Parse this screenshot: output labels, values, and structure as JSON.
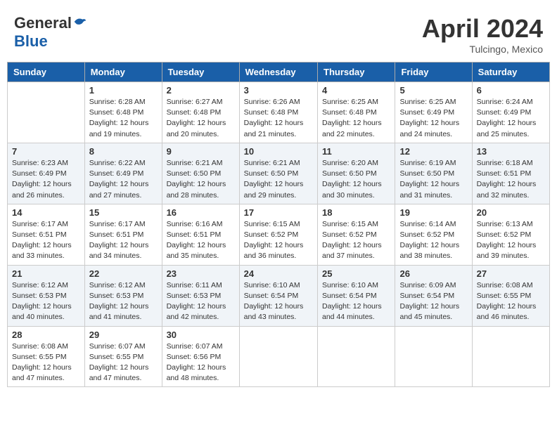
{
  "header": {
    "logo_general": "General",
    "logo_blue": "Blue",
    "month_title": "April 2024",
    "location": "Tulcingo, Mexico"
  },
  "weekdays": [
    "Sunday",
    "Monday",
    "Tuesday",
    "Wednesday",
    "Thursday",
    "Friday",
    "Saturday"
  ],
  "weeks": [
    [
      {
        "day": "",
        "sunrise": "",
        "sunset": "",
        "daylight": ""
      },
      {
        "day": "1",
        "sunrise": "Sunrise: 6:28 AM",
        "sunset": "Sunset: 6:48 PM",
        "daylight": "Daylight: 12 hours and 19 minutes."
      },
      {
        "day": "2",
        "sunrise": "Sunrise: 6:27 AM",
        "sunset": "Sunset: 6:48 PM",
        "daylight": "Daylight: 12 hours and 20 minutes."
      },
      {
        "day": "3",
        "sunrise": "Sunrise: 6:26 AM",
        "sunset": "Sunset: 6:48 PM",
        "daylight": "Daylight: 12 hours and 21 minutes."
      },
      {
        "day": "4",
        "sunrise": "Sunrise: 6:25 AM",
        "sunset": "Sunset: 6:48 PM",
        "daylight": "Daylight: 12 hours and 22 minutes."
      },
      {
        "day": "5",
        "sunrise": "Sunrise: 6:25 AM",
        "sunset": "Sunset: 6:49 PM",
        "daylight": "Daylight: 12 hours and 24 minutes."
      },
      {
        "day": "6",
        "sunrise": "Sunrise: 6:24 AM",
        "sunset": "Sunset: 6:49 PM",
        "daylight": "Daylight: 12 hours and 25 minutes."
      }
    ],
    [
      {
        "day": "7",
        "sunrise": "Sunrise: 6:23 AM",
        "sunset": "Sunset: 6:49 PM",
        "daylight": "Daylight: 12 hours and 26 minutes."
      },
      {
        "day": "8",
        "sunrise": "Sunrise: 6:22 AM",
        "sunset": "Sunset: 6:49 PM",
        "daylight": "Daylight: 12 hours and 27 minutes."
      },
      {
        "day": "9",
        "sunrise": "Sunrise: 6:21 AM",
        "sunset": "Sunset: 6:50 PM",
        "daylight": "Daylight: 12 hours and 28 minutes."
      },
      {
        "day": "10",
        "sunrise": "Sunrise: 6:21 AM",
        "sunset": "Sunset: 6:50 PM",
        "daylight": "Daylight: 12 hours and 29 minutes."
      },
      {
        "day": "11",
        "sunrise": "Sunrise: 6:20 AM",
        "sunset": "Sunset: 6:50 PM",
        "daylight": "Daylight: 12 hours and 30 minutes."
      },
      {
        "day": "12",
        "sunrise": "Sunrise: 6:19 AM",
        "sunset": "Sunset: 6:50 PM",
        "daylight": "Daylight: 12 hours and 31 minutes."
      },
      {
        "day": "13",
        "sunrise": "Sunrise: 6:18 AM",
        "sunset": "Sunset: 6:51 PM",
        "daylight": "Daylight: 12 hours and 32 minutes."
      }
    ],
    [
      {
        "day": "14",
        "sunrise": "Sunrise: 6:17 AM",
        "sunset": "Sunset: 6:51 PM",
        "daylight": "Daylight: 12 hours and 33 minutes."
      },
      {
        "day": "15",
        "sunrise": "Sunrise: 6:17 AM",
        "sunset": "Sunset: 6:51 PM",
        "daylight": "Daylight: 12 hours and 34 minutes."
      },
      {
        "day": "16",
        "sunrise": "Sunrise: 6:16 AM",
        "sunset": "Sunset: 6:51 PM",
        "daylight": "Daylight: 12 hours and 35 minutes."
      },
      {
        "day": "17",
        "sunrise": "Sunrise: 6:15 AM",
        "sunset": "Sunset: 6:52 PM",
        "daylight": "Daylight: 12 hours and 36 minutes."
      },
      {
        "day": "18",
        "sunrise": "Sunrise: 6:15 AM",
        "sunset": "Sunset: 6:52 PM",
        "daylight": "Daylight: 12 hours and 37 minutes."
      },
      {
        "day": "19",
        "sunrise": "Sunrise: 6:14 AM",
        "sunset": "Sunset: 6:52 PM",
        "daylight": "Daylight: 12 hours and 38 minutes."
      },
      {
        "day": "20",
        "sunrise": "Sunrise: 6:13 AM",
        "sunset": "Sunset: 6:52 PM",
        "daylight": "Daylight: 12 hours and 39 minutes."
      }
    ],
    [
      {
        "day": "21",
        "sunrise": "Sunrise: 6:12 AM",
        "sunset": "Sunset: 6:53 PM",
        "daylight": "Daylight: 12 hours and 40 minutes."
      },
      {
        "day": "22",
        "sunrise": "Sunrise: 6:12 AM",
        "sunset": "Sunset: 6:53 PM",
        "daylight": "Daylight: 12 hours and 41 minutes."
      },
      {
        "day": "23",
        "sunrise": "Sunrise: 6:11 AM",
        "sunset": "Sunset: 6:53 PM",
        "daylight": "Daylight: 12 hours and 42 minutes."
      },
      {
        "day": "24",
        "sunrise": "Sunrise: 6:10 AM",
        "sunset": "Sunset: 6:54 PM",
        "daylight": "Daylight: 12 hours and 43 minutes."
      },
      {
        "day": "25",
        "sunrise": "Sunrise: 6:10 AM",
        "sunset": "Sunset: 6:54 PM",
        "daylight": "Daylight: 12 hours and 44 minutes."
      },
      {
        "day": "26",
        "sunrise": "Sunrise: 6:09 AM",
        "sunset": "Sunset: 6:54 PM",
        "daylight": "Daylight: 12 hours and 45 minutes."
      },
      {
        "day": "27",
        "sunrise": "Sunrise: 6:08 AM",
        "sunset": "Sunset: 6:55 PM",
        "daylight": "Daylight: 12 hours and 46 minutes."
      }
    ],
    [
      {
        "day": "28",
        "sunrise": "Sunrise: 6:08 AM",
        "sunset": "Sunset: 6:55 PM",
        "daylight": "Daylight: 12 hours and 47 minutes."
      },
      {
        "day": "29",
        "sunrise": "Sunrise: 6:07 AM",
        "sunset": "Sunset: 6:55 PM",
        "daylight": "Daylight: 12 hours and 47 minutes."
      },
      {
        "day": "30",
        "sunrise": "Sunrise: 6:07 AM",
        "sunset": "Sunset: 6:56 PM",
        "daylight": "Daylight: 12 hours and 48 minutes."
      },
      {
        "day": "",
        "sunrise": "",
        "sunset": "",
        "daylight": ""
      },
      {
        "day": "",
        "sunrise": "",
        "sunset": "",
        "daylight": ""
      },
      {
        "day": "",
        "sunrise": "",
        "sunset": "",
        "daylight": ""
      },
      {
        "day": "",
        "sunrise": "",
        "sunset": "",
        "daylight": ""
      }
    ]
  ]
}
